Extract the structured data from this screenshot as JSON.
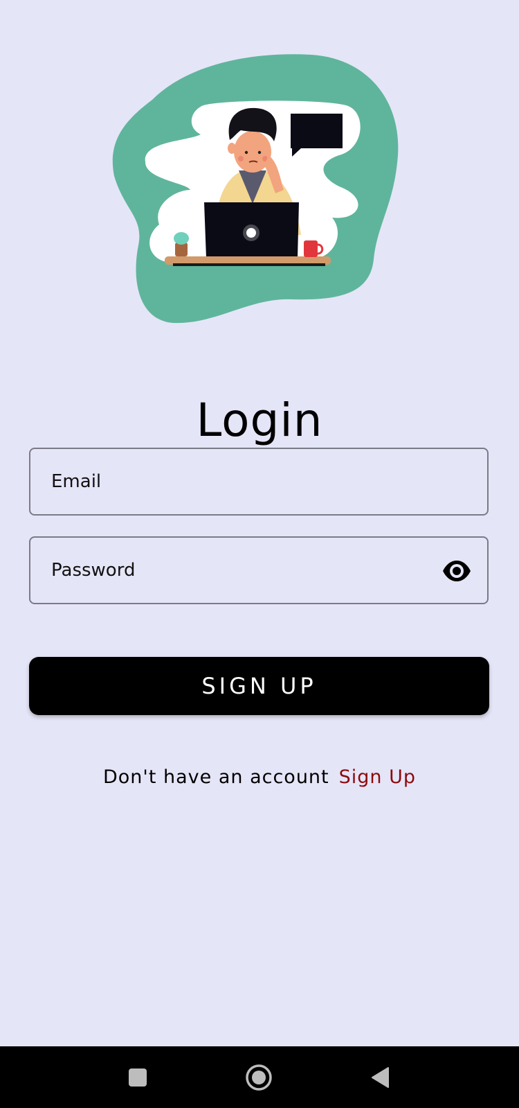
{
  "header": {
    "title": "Login"
  },
  "form": {
    "email_placeholder": "Email",
    "password_placeholder": "Password",
    "toggle_visibility_icon": "eye-icon",
    "submit_label": "SIGN UP"
  },
  "footer": {
    "prompt": "Don't have an account",
    "link_label": "Sign Up"
  },
  "navbar": {
    "recent_icon": "square-icon",
    "home_icon": "circle-icon",
    "back_icon": "triangle-back-icon"
  },
  "colors": {
    "background": "#e5e5f8",
    "accent_green": "#5fb59b",
    "button": "#000000",
    "link": "#8c0a0a"
  }
}
